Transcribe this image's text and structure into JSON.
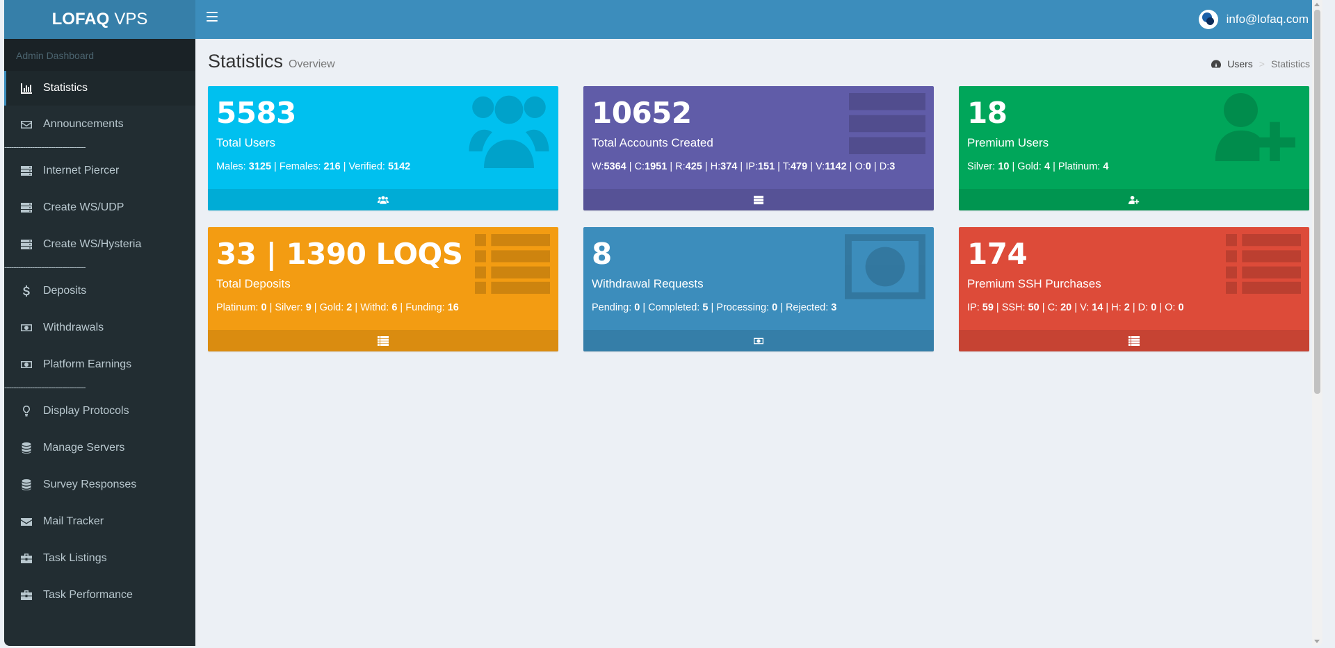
{
  "app": {
    "logo_bold": "LOFAQ",
    "logo_light": "VPS"
  },
  "header": {
    "user_email": "info@lofaq.com"
  },
  "sidebar": {
    "header": "Admin Dashboard",
    "separator": "-----------------------------------",
    "items": [
      {
        "label": "Statistics",
        "icon": "bar-chart-icon"
      },
      {
        "label": "Announcements",
        "icon": "envelope-icon"
      },
      {
        "label": "Internet Piercer",
        "icon": "server-icon"
      },
      {
        "label": "Create WS/UDP",
        "icon": "server-icon"
      },
      {
        "label": "Create WS/Hysteria",
        "icon": "server-icon"
      },
      {
        "label": "Deposits",
        "icon": "dollar-icon"
      },
      {
        "label": "Withdrawals",
        "icon": "money-icon"
      },
      {
        "label": "Platform Earnings",
        "icon": "money-icon"
      },
      {
        "label": "Display Protocols",
        "icon": "lightbulb-icon"
      },
      {
        "label": "Manage Servers",
        "icon": "database-icon"
      },
      {
        "label": "Survey Responses",
        "icon": "database-icon"
      },
      {
        "label": "Mail Tracker",
        "icon": "envelope-filled-icon"
      },
      {
        "label": "Task Listings",
        "icon": "briefcase-icon"
      },
      {
        "label": "Task Performance",
        "icon": "briefcase-icon"
      }
    ]
  },
  "page": {
    "title": "Statistics",
    "subtitle": "Overview"
  },
  "breadcrumb": {
    "home": "Users",
    "separator": ">",
    "current": "Statistics"
  },
  "boxes": {
    "users": {
      "value": "5583",
      "label": "Total Users",
      "d": [
        "Males: ",
        "3125",
        " | Females: ",
        "216",
        " | Verified: ",
        "5142"
      ]
    },
    "accounts": {
      "value": "10652",
      "label": "Total Accounts Created",
      "d": [
        "W:",
        "5364",
        " | C:",
        "1951",
        " | R:",
        "425",
        " | H:",
        "374",
        " | IP:",
        "151",
        " | T:",
        "479",
        " | V:",
        "1142",
        " | O:",
        "0",
        " | D:",
        "3"
      ]
    },
    "premium": {
      "value": "18",
      "label": "Premium Users",
      "d": [
        "Silver: ",
        "10",
        " | Gold: ",
        "4",
        " | Platinum: ",
        "4"
      ]
    },
    "deposits": {
      "value": "33 | 1390 LOQS",
      "label": "Total Deposits",
      "d": [
        "Platinum: ",
        "0",
        " | Silver: ",
        "9",
        " | Gold: ",
        "2",
        " | Withd: ",
        "6",
        " | Funding: ",
        "16"
      ]
    },
    "withdrawals": {
      "value": "8",
      "label": "Withdrawal Requests",
      "d": [
        "Pending: ",
        "0",
        " | Completed: ",
        "5",
        " | Processing: ",
        "0",
        " | Rejected: ",
        "3"
      ]
    },
    "ssh": {
      "value": "174",
      "label": "Premium SSH Purchases",
      "d": [
        "IP: ",
        "59",
        " | SSH: ",
        "50",
        " | C: ",
        "20",
        " | V: ",
        "14",
        " | H: ",
        "2",
        " | D: ",
        "0",
        " | O: ",
        "0"
      ]
    }
  },
  "colors": {
    "aqua": "#00c0ef",
    "purple": "#605ca8",
    "green": "#00a65a",
    "yellow": "#f39c12",
    "blue": "#3c8dbc",
    "red": "#dd4b39",
    "sidebar": "#222d32",
    "header": "#3c8dbc"
  }
}
